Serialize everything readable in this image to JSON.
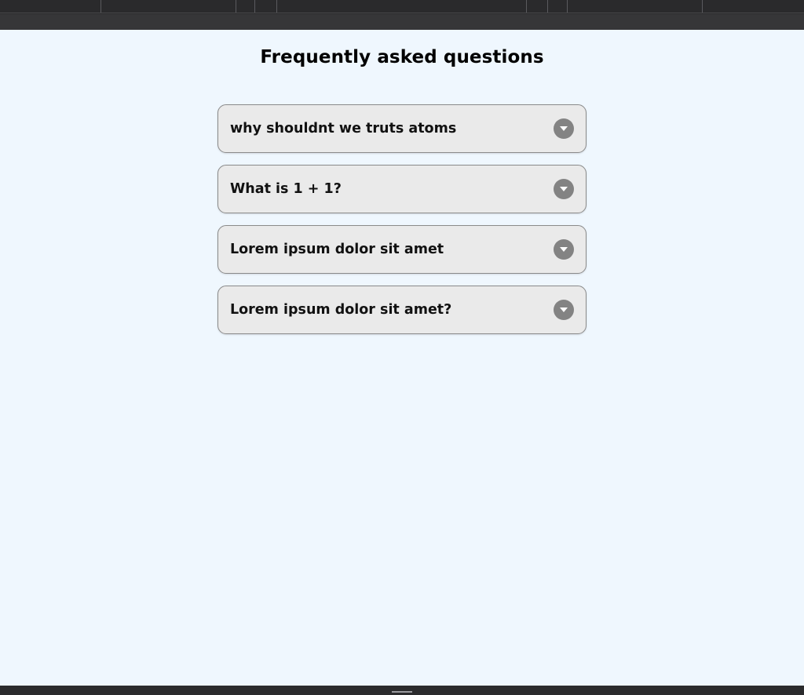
{
  "page": {
    "title": "Frequently asked questions"
  },
  "faq": {
    "items": [
      {
        "question": "why shouldnt we truts atoms",
        "toggle_icon": "chevron-down-icon"
      },
      {
        "question": "What is 1 + 1?",
        "toggle_icon": "chevron-down-icon"
      },
      {
        "question": "Lorem ipsum dolor sit amet",
        "toggle_icon": "chevron-down-icon"
      },
      {
        "question": "Lorem ipsum dolor sit amet?",
        "toggle_icon": "chevron-down-icon"
      }
    ]
  },
  "colors": {
    "background": "#eff7fe",
    "card": "#eaeaea",
    "card_border": "#8a8a8a",
    "toggle": "#838383",
    "chrome": "#2b2b2d"
  }
}
